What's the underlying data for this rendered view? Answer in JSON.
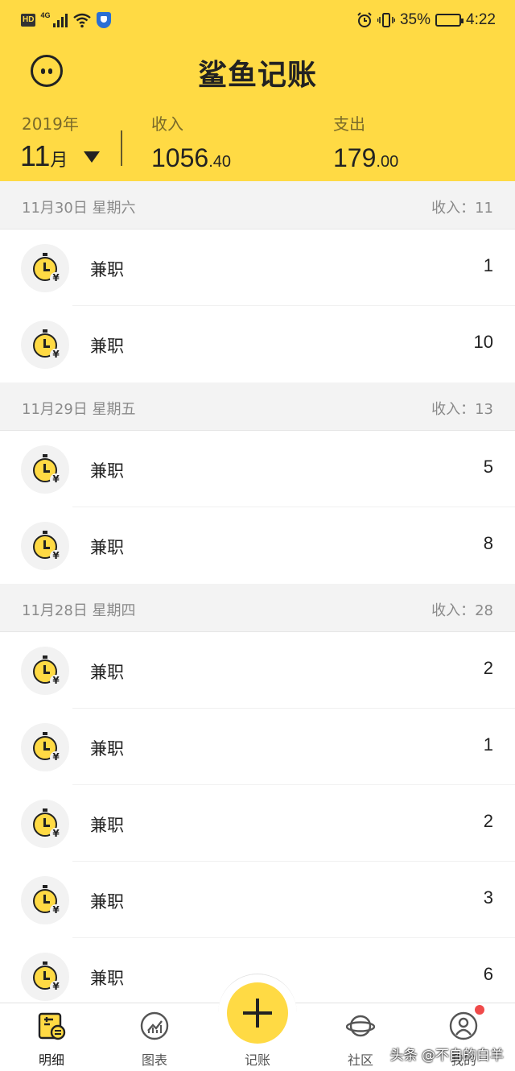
{
  "status_bar": {
    "hd": "HD",
    "network": "4G",
    "battery_percent": "35%",
    "battery_level": 0.35,
    "time": "4:22"
  },
  "header": {
    "app_title": "鲨鱼记账",
    "year": "2019年",
    "month": "11",
    "month_unit": "月",
    "income_label": "收入",
    "income_int": "1056",
    "income_dec": ".40",
    "expense_label": "支出",
    "expense_int": "179",
    "expense_dec": ".00"
  },
  "days": [
    {
      "date": "11月30日 星期六",
      "total": "收入：11",
      "items": [
        {
          "category": "兼职",
          "amount": "1"
        },
        {
          "category": "兼职",
          "amount": "10"
        }
      ]
    },
    {
      "date": "11月29日 星期五",
      "total": "收入：13",
      "items": [
        {
          "category": "兼职",
          "amount": "5"
        },
        {
          "category": "兼职",
          "amount": "8"
        }
      ]
    },
    {
      "date": "11月28日 星期四",
      "total": "收入：28",
      "items": [
        {
          "category": "兼职",
          "amount": "2"
        },
        {
          "category": "兼职",
          "amount": "1"
        },
        {
          "category": "兼职",
          "amount": "2"
        },
        {
          "category": "兼职",
          "amount": "3"
        },
        {
          "category": "兼职",
          "amount": "6"
        }
      ]
    }
  ],
  "tabs": {
    "details": "明细",
    "charts": "图表",
    "add": "记账",
    "community": "社区",
    "mine": "我的"
  },
  "watermark": "头条 @不自的白羊",
  "colors": {
    "accent": "#FFDA44",
    "badge": "#f04a4a"
  }
}
